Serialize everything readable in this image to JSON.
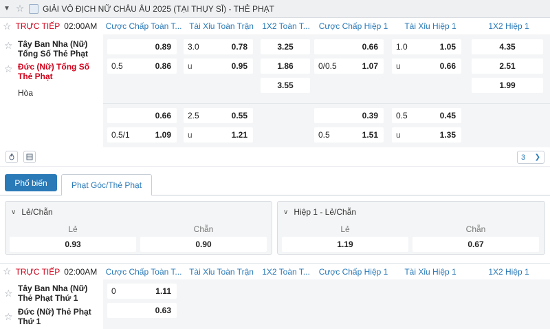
{
  "league": {
    "name": "GIẢI VÔ ĐỊCH NỮ CHÂU ÂU 2025 (TẠI THỤY SĨ) - THẺ PHẠT"
  },
  "columns": [
    "Cược Chấp Toàn T...",
    "Tài Xỉu Toàn Trận",
    "1X2 Toàn T...",
    "Cược Chấp Hiệp 1",
    "Tài Xỉu Hiệp 1",
    "1X2 Hiệp 1"
  ],
  "match1": {
    "live_label": "TRỰC TIẾP",
    "time": "02:00AM",
    "home": "Tây Ban Nha (Nữ) Tổng Số Thẻ Phạt",
    "away": "Đức (Nữ) Tổng Số Thẻ Phạt",
    "draw": "Hòa",
    "row1": {
      "hdp_line": "",
      "hdp_home": "0.89",
      "ou_line": "3.0",
      "ou_over": "0.78",
      "x12_home": "3.25",
      "h1_hdp_line": "",
      "h1_hdp_home": "0.66",
      "h1_ou_line": "1.0",
      "h1_ou_over": "1.05",
      "h1_x12_home": "4.35"
    },
    "row2": {
      "hdp_line": "0.5",
      "hdp_away": "0.86",
      "ou_line": "u",
      "ou_under": "0.95",
      "x12_away": "1.86",
      "h1_hdp_line": "0/0.5",
      "h1_hdp_away": "1.07",
      "h1_ou_line": "u",
      "h1_ou_under": "0.66",
      "h1_x12_away": "2.51"
    },
    "row3": {
      "x12_draw": "3.55",
      "h1_x12_draw": "1.99"
    },
    "alt1": {
      "hdp_home": "0.66",
      "ou_line": "2.5",
      "ou_over": "0.55",
      "h1_hdp_home": "0.39",
      "h1_ou_line": "0.5",
      "h1_ou_over": "0.45"
    },
    "alt2": {
      "hdp_line": "0.5/1",
      "hdp_away": "1.09",
      "ou_line": "u",
      "ou_under": "1.21",
      "h1_hdp_line": "0.5",
      "h1_hdp_away": "1.51",
      "h1_ou_line": "u",
      "h1_ou_under": "1.35"
    },
    "more_count": "3"
  },
  "tabs": [
    "Phổ biến",
    "Phạt Góc/Thẻ Phạt"
  ],
  "panels": [
    {
      "title": "Lẻ/Chẵn",
      "odd_label": "Lẻ",
      "even_label": "Chẵn",
      "odd_value": "0.93",
      "even_value": "0.90"
    },
    {
      "title": "Hiệp 1 - Lẻ/Chẵn",
      "odd_label": "Lẻ",
      "even_label": "Chẵn",
      "odd_value": "1.19",
      "even_value": "0.67"
    }
  ],
  "match2": {
    "live_label": "TRỰC TIẾP",
    "time": "02:00AM",
    "home": "Tây Ban Nha (Nữ) Thẻ Phạt Thứ 1",
    "away": "Đức (Nữ) Thẻ Phạt Thứ 1",
    "hdp_line": "0",
    "hdp_home": "1.11",
    "hdp_away": "0.63"
  }
}
